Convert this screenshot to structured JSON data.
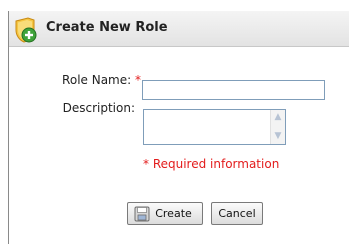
{
  "dialog": {
    "title": "Create New Role",
    "title_icon": "shield-plus-icon",
    "accent_color": "#f3b33d",
    "required_color": "#e31c1c"
  },
  "form": {
    "role_name_label": "Role Name:",
    "required_marker": "*",
    "role_name_value": "",
    "description_label": "Description:",
    "description_value": "",
    "required_note": "* Required information"
  },
  "buttons": {
    "create_label": "Create",
    "create_icon": "disk-icon",
    "cancel_label": "Cancel"
  }
}
